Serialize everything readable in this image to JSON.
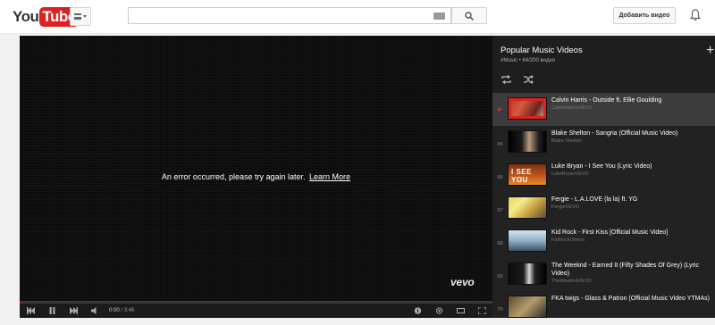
{
  "masthead": {
    "logo_you": "You",
    "logo_tube": "Tube",
    "logo_region": "UA",
    "search_placeholder": "",
    "upload_label": "Добавить видео"
  },
  "player": {
    "error_text": "An error occurred, please try again later.",
    "learn_more": "Learn More",
    "watermark": "vevo",
    "time_current": "0:00",
    "time_total": "3:46",
    "progress": 0.0
  },
  "playlist": {
    "title": "Popular Music Videos",
    "subtitle": "#Music • 64/200 видео",
    "add_symbol": "+",
    "items": [
      {
        "index": "▶",
        "title": "Calvin Harris - Outside ft. Ellie Goulding",
        "channel": "CalvinHarrisVEVO",
        "thumb": "t1",
        "active": true
      },
      {
        "index": "65",
        "title": "Blake Shelton - Sangria (Official Music Video)",
        "channel": "Blake Shelton",
        "thumb": "t2",
        "active": false
      },
      {
        "index": "66",
        "title": "Luke Bryan - I See You (Lyric Video)",
        "channel": "LukeBryanVEVO",
        "thumb": "t3",
        "thumb_text": "I SEE YOU",
        "active": false
      },
      {
        "index": "67",
        "title": "Fergie - L.A.LOVE (la la) ft. YG",
        "channel": "FergieVEVO",
        "thumb": "t4",
        "active": false
      },
      {
        "index": "68",
        "title": "Kid Rock - First Kiss [Official Music Video]",
        "channel": "KidRockVideos",
        "thumb": "t5",
        "active": false
      },
      {
        "index": "69",
        "title": "The Weeknd - Earned It (Fifty Shades Of Grey) (Lyric Video)",
        "channel": "TheWeekndVEVO",
        "thumb": "t6",
        "active": false
      },
      {
        "index": "70",
        "title": "FKA twigs - Glass & Patron (Official Music Video YTMAs)",
        "channel": "",
        "thumb": "t7",
        "active": false
      }
    ]
  },
  "colors": {
    "brand_red": "#d92323",
    "progress_red": "#cc0000",
    "playlist_bg": "#222222",
    "active_row": "#3c3c3c"
  }
}
